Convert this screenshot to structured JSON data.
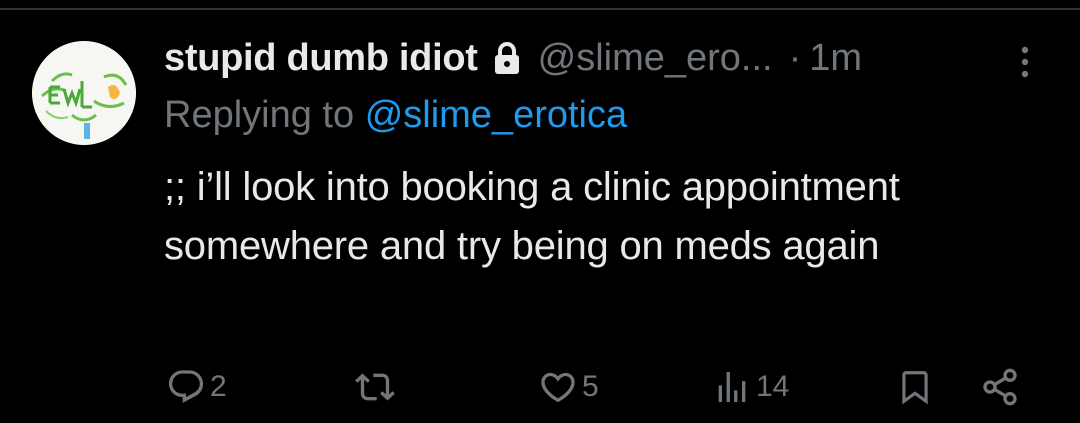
{
  "tweet": {
    "display_name": "stupid dumb idiot",
    "handle": "@slime_ero...",
    "separator": "·",
    "time": "1m",
    "replying_prefix": "Replying to",
    "replying_to": "@slime_erotica",
    "text": ";; i’ll look into booking a clinic appointment somewhere and try being on meds again"
  },
  "actions": {
    "reply_count": "2",
    "like_count": "5",
    "views_count": "14"
  },
  "colors": {
    "background": "#000000",
    "primary_text": "#e7e9ea",
    "secondary_text": "#71767b",
    "link": "#1d9bf0"
  },
  "icons": {
    "lock": "lock-icon",
    "more": "more-vertical-icon",
    "reply": "reply-icon",
    "retweet": "retweet-icon",
    "like": "heart-icon",
    "views": "views-icon",
    "bookmark": "bookmark-icon",
    "share": "share-icon"
  }
}
